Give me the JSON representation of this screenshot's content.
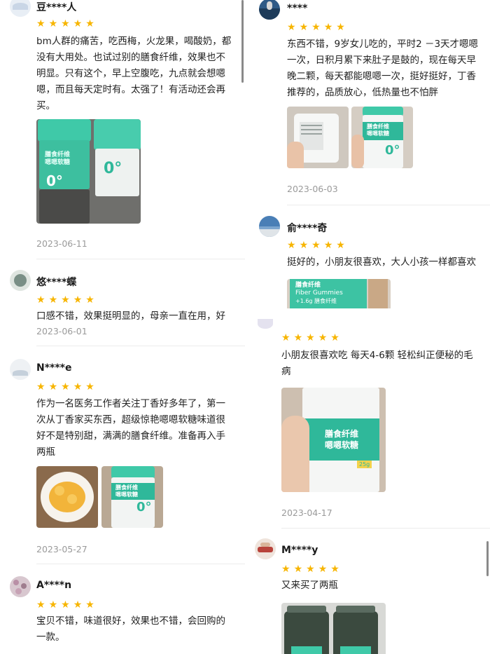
{
  "colors": {
    "star": "#f7b500",
    "brand_teal": "#3fc9a8",
    "date_gray": "#9a9a9a"
  },
  "star_glyph": "★",
  "left_reviews": [
    {
      "user": "豆****人",
      "rating": 5,
      "lines": [
        "bm人群的痛苦，吃西梅，火龙果，喝酸奶，都",
        "没有大用处。也试过别的膳食纤维，效果也不",
        "明显。只有这个，早上空腹吃，九点就会想嗯",
        "嗯，而且每天定时有。太强了！有活动还会再",
        "买。"
      ],
      "date": "2023-06-11"
    },
    {
      "user": "悠****蝶",
      "rating": 5,
      "lines": [
        "口感不错，效果挺明显的，母亲一直在用，好"
      ],
      "date": "2023-06-01"
    },
    {
      "user": "N****e",
      "rating": 5,
      "lines": [
        "作为一名医务工作者关注丁香好多年了，第一",
        "次从丁香家买东西，超级惊艳嗯嗯软糖味道很",
        "好不是特别甜，满满的膳食纤维。准备再入手",
        "两瓶"
      ],
      "date": "2023-05-27"
    },
    {
      "user": "A****n",
      "rating": 5,
      "lines": [
        "宝贝不错，味道很好，效果也不错，会回购的",
        "一款。"
      ]
    }
  ],
  "right_reviews": [
    {
      "user": "****",
      "rating": 5,
      "lines": [
        "东西不错，9岁女儿吃的，平时2 －3天才嗯嗯",
        "一次，日积月累下来肚子是鼓的，现在每天早",
        "晚二颗，每天都能嗯嗯一次，挺好挺好，丁香",
        "推荐的，品质放心，低热量也不怕胖"
      ],
      "date": "2023-06-03"
    },
    {
      "user": "俞****奇",
      "rating": 5,
      "lines": [
        "挺好的，小朋友很喜欢，大人小孩一样都喜欢"
      ]
    },
    {
      "rating": 5,
      "lines": [
        "小朋友很喜欢吃 每天4-6颗 轻松纠正便秘的毛",
        "病"
      ],
      "date": "2023-04-17"
    },
    {
      "user": "M****y",
      "rating": 5,
      "lines": [
        "又来买了两瓶"
      ]
    }
  ],
  "product": {
    "name_line1": "膳食纤维",
    "name_line2": "嗯嗯软糖",
    "english": "Fiber Gummies",
    "big_mark": "0°",
    "fiber_note": "+1.6g 膳食纤维",
    "weight": "25g"
  }
}
